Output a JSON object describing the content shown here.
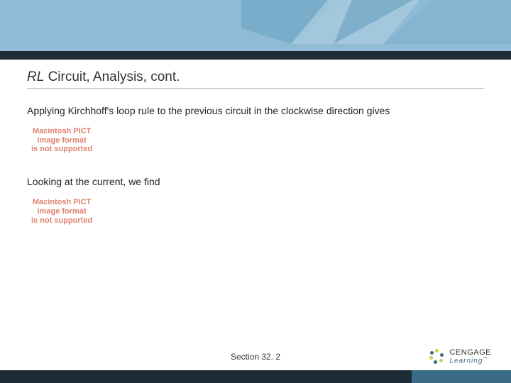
{
  "title_prefix": "RL",
  "title_rest": " Circuit, Analysis, cont.",
  "para1": "Applying Kirchhoff's loop rule to the previous circuit in the clockwise direction gives",
  "para2": "Looking at the current, we find",
  "pict": {
    "l1": "Macintosh PICT",
    "l2": "image format",
    "l3": "is not supported"
  },
  "section": "Section  32. 2",
  "logo": {
    "brand": "CENGAGE",
    "sub": "Learning",
    "tm": "™"
  },
  "colors": {
    "band": "#8fbbd5",
    "dark": "#1d2b36",
    "accent": "#3a6b87",
    "pict": "#e0816b"
  }
}
